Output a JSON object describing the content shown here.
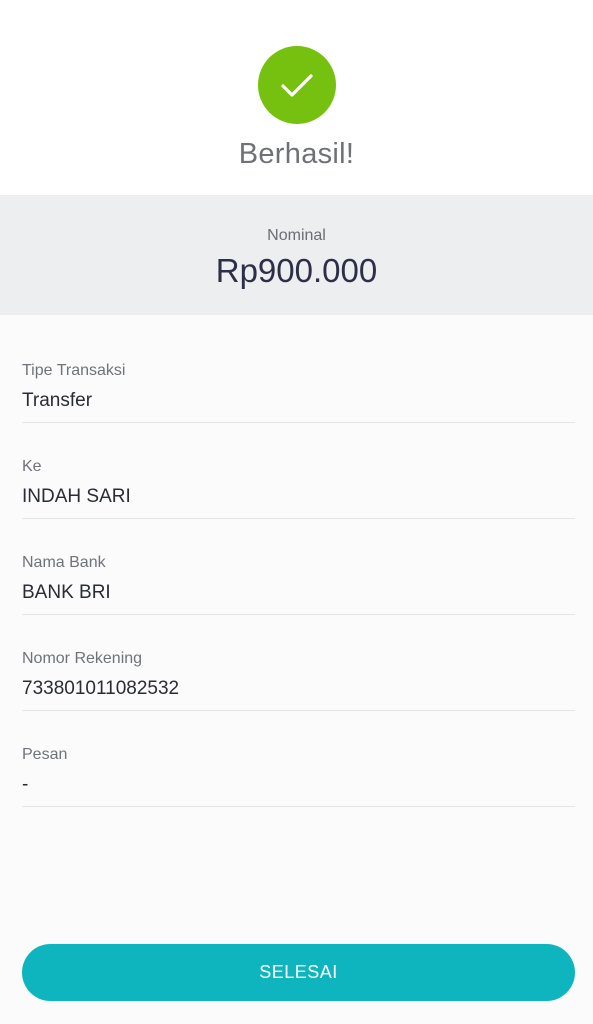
{
  "colors": {
    "success": "#76c10f",
    "accent": "#0fb5be"
  },
  "status": {
    "icon": "checkmark-icon",
    "title": "Berhasil!"
  },
  "amount": {
    "label": "Nominal",
    "value": "Rp900.000"
  },
  "details": [
    {
      "label": "Tipe Transaksi",
      "value": "Transfer"
    },
    {
      "label": "Ke",
      "value": "INDAH SARI"
    },
    {
      "label": "Nama Bank",
      "value": "BANK BRI"
    },
    {
      "label": "Nomor Rekening",
      "value": "733801011082532"
    },
    {
      "label": "Pesan",
      "value": "-"
    }
  ],
  "actions": {
    "done_label": "SELESAI"
  }
}
